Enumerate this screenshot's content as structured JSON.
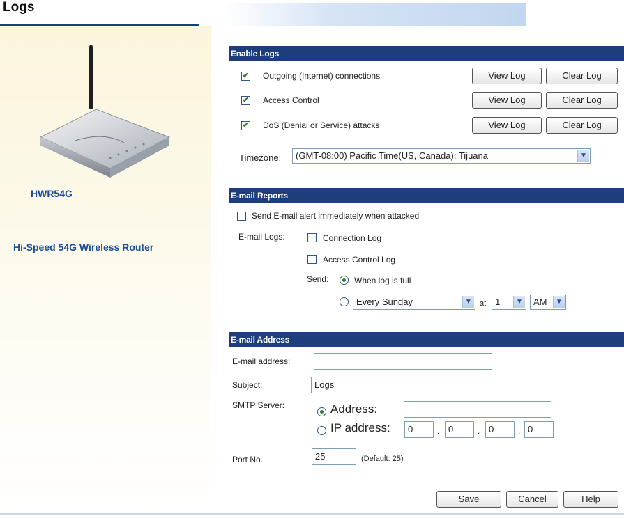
{
  "page": {
    "title": "Logs"
  },
  "sidebar": {
    "model": "HWR54G",
    "description": "Hi-Speed 54G Wireless Router"
  },
  "enable_logs": {
    "header": "Enable Logs",
    "items": [
      {
        "label": "Outgoing (Internet) connections",
        "checked": true,
        "view": "View Log",
        "clear": "Clear Log"
      },
      {
        "label": "Access Control",
        "checked": true,
        "view": "View Log",
        "clear": "Clear Log"
      },
      {
        "label": "DoS (Denial or Service) attacks",
        "checked": true,
        "view": "View Log",
        "clear": "Clear Log"
      }
    ],
    "timezone_label": "Timezone:",
    "timezone_value": "(GMT-08:00) Pacific Time(US, Canada); Tijuana"
  },
  "email_reports": {
    "header": "E-mail Reports",
    "alert_label": "Send E-mail alert immediately when attacked",
    "email_logs_label": "E-mail Logs:",
    "connection_log": "Connection Log",
    "access_control_log": "Access Control Log",
    "send_label": "Send:",
    "when_full": "When log is full",
    "schedule_day": "Every Sunday",
    "at_label": "at",
    "hour": "1",
    "ampm": "AM"
  },
  "email_address": {
    "header": "E-mail Address",
    "address_label": "E-mail address:",
    "address_value": "",
    "subject_label": "Subject:",
    "subject_value": "Logs",
    "smtp_label": "SMTP Server:",
    "address_radio": "Address:",
    "address_server_value": "",
    "ip_radio": "IP address:",
    "ip": [
      "0",
      "0",
      "0",
      "0"
    ],
    "dot": ".",
    "port_label": "Port No.",
    "port_value": "25",
    "port_default": "(Default: 25)"
  },
  "footer": {
    "save": "Save",
    "cancel": "Cancel",
    "help": "Help"
  },
  "colors": {
    "section_header": "#1d3d7d",
    "brand_text": "#1b4d98",
    "check": "#2a7d2a"
  }
}
